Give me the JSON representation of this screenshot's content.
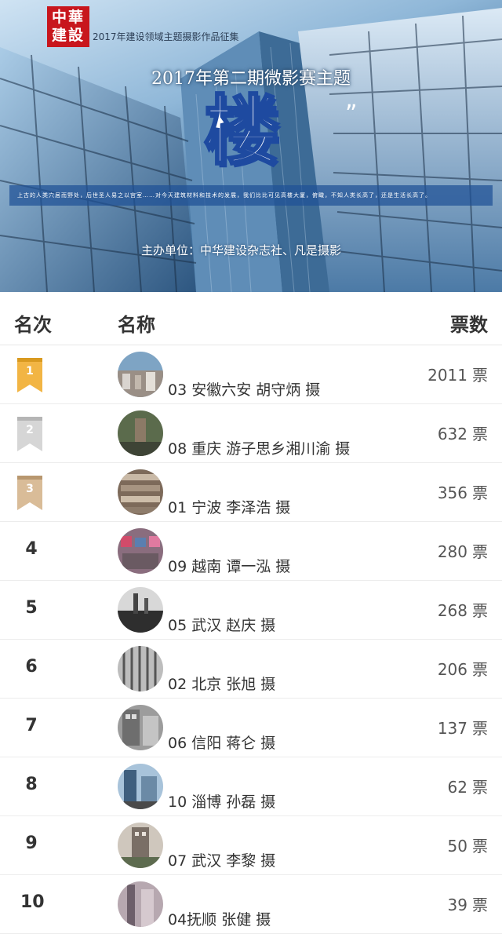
{
  "banner": {
    "logo_line1": "中華",
    "logo_line2": "建設",
    "caption": "2017年建设领域主题摄影作品征集",
    "subtitle": "2017年第二期微影赛主题",
    "title": "楼",
    "description": "上古的人类穴居而野处，后世圣人易之以宫室……对今天建筑材料和技术的发展，我们比比可见高楼大厦，俯瞰，不知人类长高了，还是生活长高了。",
    "organizer": "主办单位：中华建设杂志社、凡是摄影"
  },
  "header": {
    "rank": "名次",
    "name": "名称",
    "votes": "票数"
  },
  "vote_unit": "票",
  "colors": {
    "gold": "#f2b544",
    "silver": "#d6d6d6",
    "bronze": "#d9bc98"
  },
  "entries": [
    {
      "rank": "1",
      "badge": "gold",
      "name": "03 安徽六安  胡守炳 摄",
      "votes": "2011"
    },
    {
      "rank": "2",
      "badge": "silver",
      "name": "08 重庆  游子思乡湘川渝 摄",
      "votes": "632"
    },
    {
      "rank": "3",
      "badge": "bronze",
      "name": "01 宁波  李泽浩 摄",
      "votes": "356"
    },
    {
      "rank": "4",
      "name": "09 越南  谭一泓 摄",
      "votes": "280"
    },
    {
      "rank": "5",
      "name": "05 武汉  赵庆 摄",
      "votes": "268"
    },
    {
      "rank": "6",
      "name": "02 北京  张旭 摄",
      "votes": "206"
    },
    {
      "rank": "7",
      "name": "06 信阳  蒋仑 摄",
      "votes": "137"
    },
    {
      "rank": "8",
      "name": "10 淄博  孙磊 摄",
      "votes": "62"
    },
    {
      "rank": "9",
      "name": "07 武汉  李黎 摄",
      "votes": "50"
    },
    {
      "rank": "10",
      "name": "04抚顺  张健 摄",
      "votes": "39"
    }
  ]
}
